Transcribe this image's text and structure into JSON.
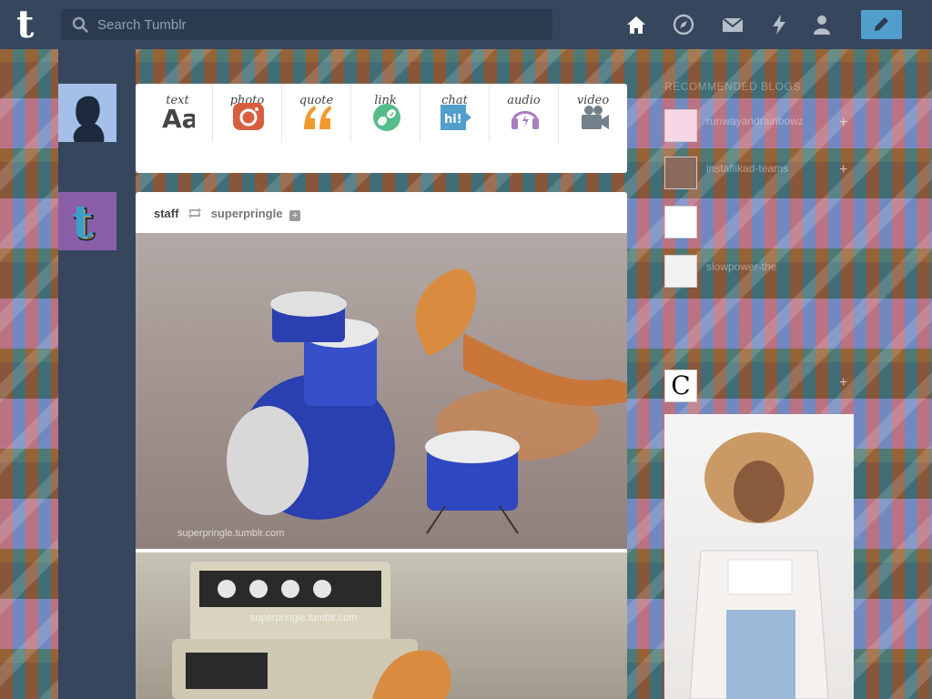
{
  "header": {
    "logo": "t",
    "search_placeholder": "Search Tumblr",
    "nav": [
      "home-icon",
      "explore-icon",
      "inbox-icon",
      "activity-icon",
      "account-icon"
    ],
    "compose_icon": "pencil-icon"
  },
  "post_types": [
    {
      "label": "text",
      "icon": "text-aa-icon",
      "glyph": "Aa",
      "color": "#444444"
    },
    {
      "label": "photo",
      "icon": "camera-icon",
      "color": "#d95e40"
    },
    {
      "label": "quote",
      "icon": "quote-icon",
      "glyph": "❝",
      "color": "#f2992e"
    },
    {
      "label": "link",
      "icon": "link-icon",
      "color": "#56bc8a"
    },
    {
      "label": "chat",
      "icon": "chat-icon",
      "glyph": "hi!",
      "color": "#529ecc"
    },
    {
      "label": "audio",
      "icon": "headphones-icon",
      "color": "#a77dc2"
    },
    {
      "label": "video",
      "icon": "video-camera-icon",
      "color": "#748089"
    }
  ],
  "post": {
    "author": "staff",
    "source": "superpringle",
    "watermark": "superpringle.tumblr.com"
  },
  "sidebar": {
    "title": "RECOMMENDED BLOGS",
    "items": [
      {
        "name": "runwayandrainbowz"
      },
      {
        "name": "instaflikad-teams"
      },
      {
        "name": ""
      },
      {
        "name": "slowpower-the"
      },
      {
        "name": "C"
      }
    ]
  },
  "colors": {
    "navy": "#36465d",
    "compose": "#529ecc"
  }
}
